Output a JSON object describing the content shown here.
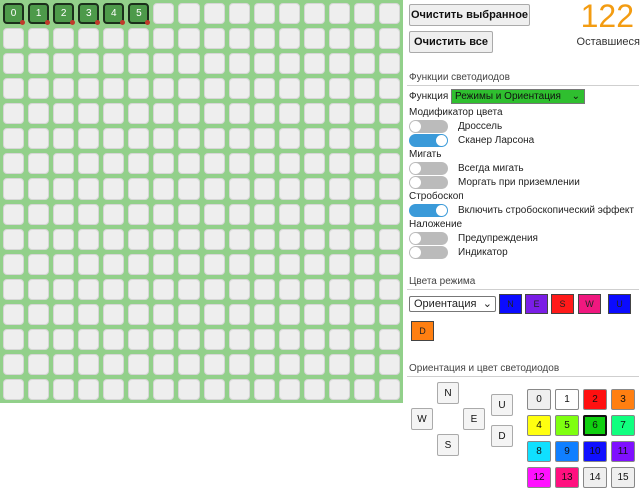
{
  "grid": {
    "columns": 16,
    "rows": 16,
    "selected_labels": [
      "0",
      "1",
      "2",
      "3",
      "4",
      "5"
    ]
  },
  "toolbar": {
    "clear_selected_label": "Очистить выбранное",
    "clear_all_label": "Очистить все"
  },
  "counter": {
    "value": "122",
    "label": "Оставшиеся"
  },
  "functions": {
    "title": "Функции светодиодов",
    "function_label": "Функция",
    "function_value": "Режимы и Ориентация",
    "color_modifier": {
      "title": "Модификатор цвета",
      "items": [
        {
          "label": "Дроссель",
          "on": false
        },
        {
          "label": "Сканер Ларсона",
          "on": true
        }
      ]
    },
    "blink": {
      "title": "Мигать",
      "items": [
        {
          "label": "Всегда мигать",
          "on": false
        },
        {
          "label": "Моргать при приземлении",
          "on": false
        }
      ]
    },
    "strobe": {
      "title": "Стробоскоп",
      "items": [
        {
          "label": "Включить стробоскопический эффект",
          "on": true
        }
      ]
    },
    "overlay": {
      "title": "Наложение",
      "items": [
        {
          "label": "Предупреждения",
          "on": false
        },
        {
          "label": "Индикатор",
          "on": false
        }
      ]
    }
  },
  "mode_colors": {
    "title": "Цвета режима",
    "select_value": "Ориентация",
    "swatches": [
      {
        "label": "N",
        "color": "#0b0bff"
      },
      {
        "label": "E",
        "color": "#7a1ee6"
      },
      {
        "label": "S",
        "color": "#ff1a1a"
      },
      {
        "label": "W",
        "color": "#f0187f"
      },
      {
        "label": "U",
        "color": "#0b0bff"
      },
      {
        "label": "D",
        "color": "#ff7f11"
      }
    ]
  },
  "orientation": {
    "title": "Ориентация и цвет светодиодов",
    "directions": [
      "N",
      "W",
      "E",
      "S",
      "U",
      "D"
    ],
    "colors": [
      {
        "label": "0",
        "color": "#efefef"
      },
      {
        "label": "1",
        "color": "#ffffff"
      },
      {
        "label": "2",
        "color": "#ff1010"
      },
      {
        "label": "3",
        "color": "#ff7f11"
      },
      {
        "label": "4",
        "color": "#ffff10"
      },
      {
        "label": "5",
        "color": "#7fff10"
      },
      {
        "label": "6",
        "color": "#10d010"
      },
      {
        "label": "7",
        "color": "#10ff7f"
      },
      {
        "label": "8",
        "color": "#10e0ff"
      },
      {
        "label": "9",
        "color": "#107fff"
      },
      {
        "label": "10",
        "color": "#1010ff"
      },
      {
        "label": "11",
        "color": "#7f10ff"
      },
      {
        "label": "12",
        "color": "#ff10ff"
      },
      {
        "label": "13",
        "color": "#ff107f"
      },
      {
        "label": "14",
        "color": "#efefef"
      },
      {
        "label": "15",
        "color": "#efefef"
      }
    ],
    "selected_color": "6"
  }
}
